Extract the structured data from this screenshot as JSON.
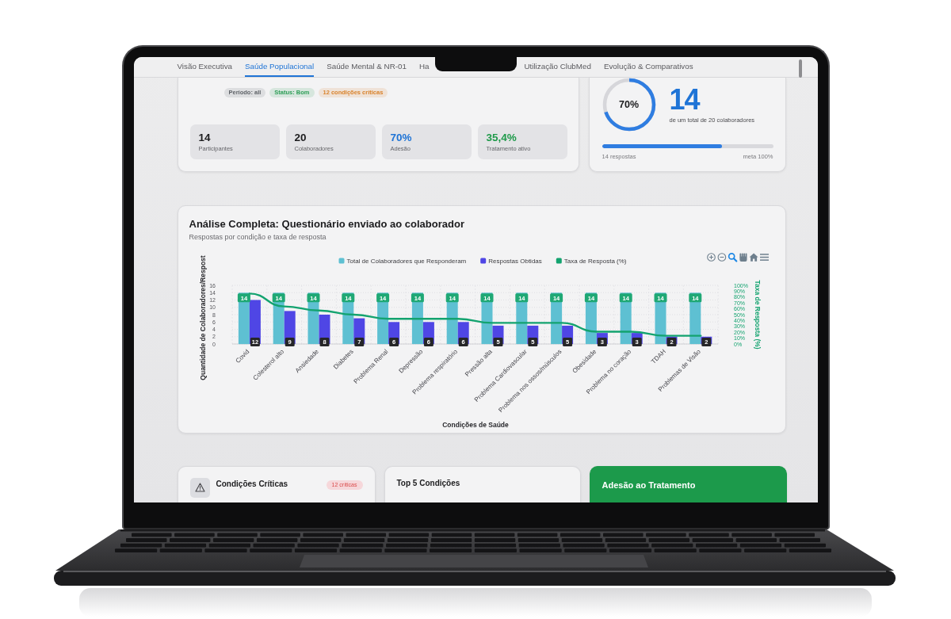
{
  "tabs": [
    {
      "label": "Visão Executiva",
      "selected": false
    },
    {
      "label": "Saúde Populacional",
      "selected": true
    },
    {
      "label": "Saúde Mental & NR-01",
      "selected": false
    },
    {
      "label": "Ha",
      "selected": false
    },
    {
      "label": "Utilização ClubMed",
      "selected": false
    },
    {
      "label": "Evolução & Comparativos",
      "selected": false
    }
  ],
  "overview_card": {
    "badges": [
      {
        "label": "Período: all",
        "color": "#5f6368"
      },
      {
        "label": "Status: Bom",
        "color": "#2e9e57"
      },
      {
        "label": "12 condições críticas",
        "color": "#d9822b"
      }
    ],
    "stats": [
      {
        "value": "14",
        "label": "Participantes",
        "color": "#1c1c1e"
      },
      {
        "value": "20",
        "label": "Colaboradores",
        "color": "#1c1c1e"
      },
      {
        "value": "70%",
        "label": "Adesão",
        "color": "#1f74d6"
      },
      {
        "value": "35,4%",
        "label": "Tratamento ativo",
        "color": "#1f9a4a"
      }
    ]
  },
  "adherence_card": {
    "ring": {
      "label": "70%",
      "level": 0.7
    },
    "count": "14",
    "caption": "de um total de 20 colaboradores",
    "progress": {
      "level": 0.7,
      "start_label": "14 respostas",
      "end_label": "meta 100%"
    }
  },
  "chart_card": {
    "title": "Análise Completa: Questionário enviado ao colaborador",
    "subtitle": "Respostas por condição e taxa de resposta",
    "toolbar": [
      {
        "kind": "zoom-in",
        "selected": false
      },
      {
        "kind": "zoom-out",
        "selected": false
      },
      {
        "kind": "zoom",
        "selected": true
      },
      {
        "kind": "pan",
        "selected": false
      },
      {
        "kind": "reset",
        "selected": false
      },
      {
        "kind": "menu",
        "selected": false
      }
    ],
    "chart_data": {
      "type": "bar",
      "xlabel": "Condições de Saúde",
      "ylabel": "Quantidade de Colaboradores/Respost",
      "y2label": "Taxa de Resposta (%)",
      "categories": [
        "Covid",
        "Colesterol alto",
        "Ansiedade",
        "Diabetes",
        "Problema Renal",
        "Depressão",
        "Problema respiratório",
        "Pressão alta",
        "Problema Cardiovascular",
        "Problema nos ossos/músculos",
        "Obesidade",
        "Problema no coração",
        "TDAH",
        "Problemas de Visão"
      ],
      "series": [
        {
          "name": "Total de Colaboradores que Responderam",
          "color": "#5ec0d2",
          "values": [
            14,
            14,
            14,
            14,
            14,
            14,
            14,
            14,
            14,
            14,
            14,
            14,
            14,
            14
          ],
          "value_labels": [
            "14",
            "14",
            "14",
            "14",
            "14",
            "14",
            "14",
            "14",
            "14",
            "14",
            "14",
            "14",
            "14",
            "14"
          ]
        },
        {
          "name": "Respostas Obtidas",
          "color": "#4f46e5",
          "values": [
            12,
            9,
            8,
            7,
            6,
            6,
            6,
            5,
            5,
            5,
            3,
            3,
            2,
            2
          ],
          "value_labels": [
            "12",
            "9",
            "8",
            "7",
            "6",
            "6",
            "6",
            "5",
            "5",
            "5",
            "3",
            "3",
            "2",
            "2"
          ]
        },
        {
          "name": "Taxa de Resposta (%)",
          "color": "#13a36f",
          "type": "line",
          "axis": "y2",
          "values": [
            86,
            64,
            57,
            50,
            43,
            43,
            43,
            36,
            36,
            36,
            21,
            21,
            14,
            14
          ]
        }
      ],
      "ylim": [
        0,
        16
      ],
      "yticks": [
        0,
        2,
        4,
        6,
        8,
        10,
        12,
        14,
        16
      ],
      "y2lim": [
        0,
        100
      ],
      "y2ticks": [
        {
          "value": 0,
          "label": "0%"
        },
        {
          "value": 10,
          "label": "10%"
        },
        {
          "value": 20,
          "label": "20%"
        },
        {
          "value": 30,
          "label": "30%"
        },
        {
          "value": 40,
          "label": "40%"
        },
        {
          "value": 50,
          "label": "50%"
        },
        {
          "value": 60,
          "label": "60%"
        },
        {
          "value": 70,
          "label": "70%"
        },
        {
          "value": 80,
          "label": "80%"
        },
        {
          "value": 90,
          "label": "90%"
        },
        {
          "value": 100,
          "label": "100%"
        }
      ],
      "grid": true,
      "legend": "top"
    }
  },
  "bottom_cards": [
    {
      "kind": "alert",
      "title": "Condições Críticas",
      "badge": "12 críticas"
    },
    {
      "kind": "list",
      "title": "Top 5 Condições"
    },
    {
      "kind": "highlight",
      "title": "Adesão ao Tratamento"
    }
  ]
}
